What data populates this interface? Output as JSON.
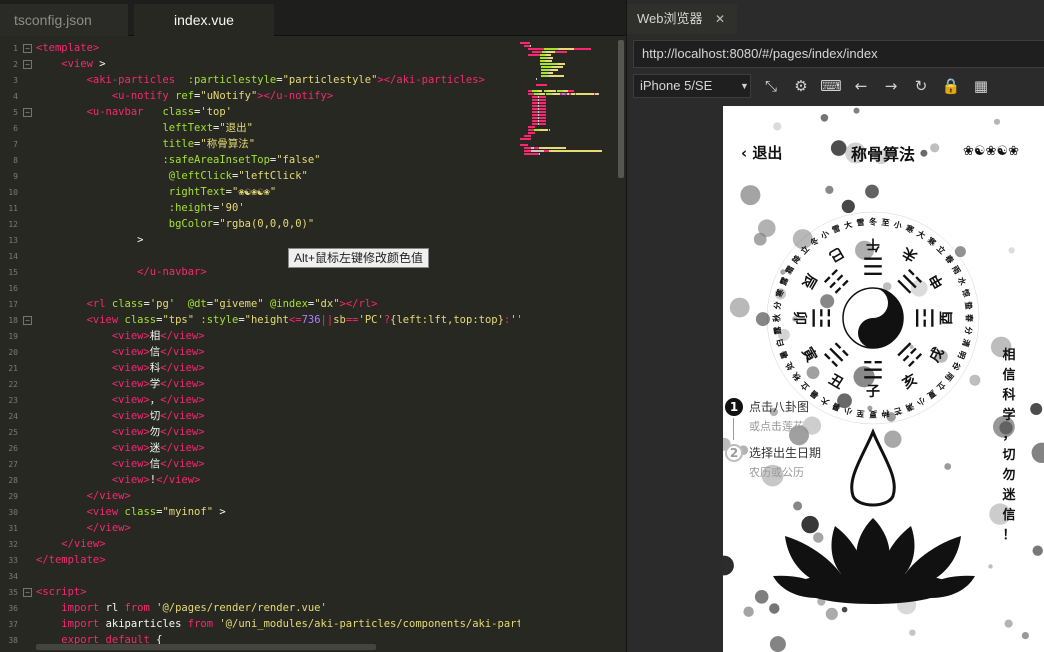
{
  "editor": {
    "tabs": [
      {
        "label": "tsconfig.json",
        "active": false
      },
      {
        "label": "index.vue",
        "active": true
      }
    ],
    "line_numbers": [
      "1",
      "2",
      "3",
      "4",
      "5",
      "6",
      "7",
      "8",
      "9",
      "10",
      "11",
      "12",
      "13",
      "14",
      "15",
      "16",
      "17",
      "18",
      "19",
      "20",
      "21",
      "22",
      "23",
      "24",
      "25",
      "26",
      "27",
      "28",
      "29",
      "30",
      "31",
      "32",
      "33",
      "34",
      "35",
      "36",
      "37",
      "38"
    ],
    "fold_lines": [
      1,
      2,
      5,
      18,
      35
    ],
    "lines": [
      [
        [
          "t",
          "<template>"
        ]
      ],
      [
        [
          "w",
          "    "
        ],
        [
          "t",
          "<view "
        ],
        [
          "p",
          ">"
        ]
      ],
      [
        [
          "w",
          "        "
        ],
        [
          "t",
          "<aki-particles  "
        ],
        [
          "a",
          ":particlestyle"
        ],
        [
          "p",
          "="
        ],
        [
          "s",
          "\"particlestyle\""
        ],
        [
          "t",
          "></aki-particles>"
        ]
      ],
      [
        [
          "w",
          "            "
        ],
        [
          "t",
          "<u-notify "
        ],
        [
          "a",
          "ref"
        ],
        [
          "p",
          "="
        ],
        [
          "s",
          "\"uNotify\""
        ],
        [
          "t",
          "></u-notify>"
        ]
      ],
      [
        [
          "w",
          "        "
        ],
        [
          "t",
          "<u-navbar   "
        ],
        [
          "a",
          "class"
        ],
        [
          "p",
          "="
        ],
        [
          "s",
          "'top'"
        ]
      ],
      [
        [
          "w",
          "                    "
        ],
        [
          "a",
          "leftText"
        ],
        [
          "p",
          "="
        ],
        [
          "s",
          "\"退出\""
        ]
      ],
      [
        [
          "w",
          "                    "
        ],
        [
          "a",
          "title"
        ],
        [
          "p",
          "="
        ],
        [
          "s",
          "\"称骨算法\""
        ]
      ],
      [
        [
          "w",
          "                    "
        ],
        [
          "a",
          ":safeAreaInsetTop"
        ],
        [
          "p",
          "="
        ],
        [
          "s",
          "\"false\""
        ]
      ],
      [
        [
          "w",
          "                     "
        ],
        [
          "a",
          "@leftClick"
        ],
        [
          "p",
          "="
        ],
        [
          "s",
          "\"leftClick\""
        ]
      ],
      [
        [
          "w",
          "                     "
        ],
        [
          "a",
          "rightText"
        ],
        [
          "p",
          "="
        ],
        [
          "s",
          "\"❀☯❀☯❀\""
        ]
      ],
      [
        [
          "w",
          "                     "
        ],
        [
          "a",
          ":height"
        ],
        [
          "p",
          "="
        ],
        [
          "s",
          "'90'"
        ]
      ],
      [
        [
          "w",
          "                     "
        ],
        [
          "a",
          "bgColor"
        ],
        [
          "p",
          "="
        ],
        [
          "s",
          "\"rgba(0,0,0,0)\""
        ]
      ],
      [
        [
          "w",
          "                "
        ],
        [
          "p",
          ">"
        ]
      ],
      [
        [
          "w",
          ""
        ]
      ],
      [
        [
          "w",
          "                "
        ],
        [
          "t",
          "</u-navbar>"
        ]
      ],
      [
        [
          "w",
          ""
        ]
      ],
      [
        [
          "w",
          "        "
        ],
        [
          "t",
          "<rl "
        ],
        [
          "a",
          "class"
        ],
        [
          "p",
          "="
        ],
        [
          "s",
          "'pg'"
        ],
        [
          "w",
          "  "
        ],
        [
          "a",
          "@dt"
        ],
        [
          "p",
          "="
        ],
        [
          "s",
          "\"giveme\""
        ],
        [
          "w",
          " "
        ],
        [
          "a",
          "@index"
        ],
        [
          "p",
          "="
        ],
        [
          "s",
          "\"dx\""
        ],
        [
          "t",
          "></rl>"
        ]
      ],
      [
        [
          "w",
          "        "
        ],
        [
          "t",
          "<view "
        ],
        [
          "a",
          "class"
        ],
        [
          "p",
          "="
        ],
        [
          "s",
          "\"tps\""
        ],
        [
          "w",
          " "
        ],
        [
          "a",
          ":style"
        ],
        [
          "p",
          "="
        ],
        [
          "s",
          "\"height"
        ],
        [
          "k",
          "<="
        ],
        [
          "n",
          "736"
        ],
        [
          "k",
          "||"
        ],
        [
          "s",
          "sb"
        ],
        [
          "k",
          "=="
        ],
        [
          "s",
          "'PC'"
        ],
        [
          "k",
          "?"
        ],
        [
          "s",
          "{left:lft,top:top}"
        ],
        [
          "k",
          ":"
        ],
        [
          "s",
          "''\""
        ],
        [
          "p",
          ">"
        ]
      ],
      [
        [
          "w",
          "            "
        ],
        [
          "t",
          "<view>"
        ],
        [
          "p",
          "相"
        ],
        [
          "t",
          "</view>"
        ]
      ],
      [
        [
          "w",
          "            "
        ],
        [
          "t",
          "<view>"
        ],
        [
          "p",
          "信"
        ],
        [
          "t",
          "</view>"
        ]
      ],
      [
        [
          "w",
          "            "
        ],
        [
          "t",
          "<view>"
        ],
        [
          "p",
          "科"
        ],
        [
          "t",
          "</view>"
        ]
      ],
      [
        [
          "w",
          "            "
        ],
        [
          "t",
          "<view>"
        ],
        [
          "p",
          "学"
        ],
        [
          "t",
          "</view>"
        ]
      ],
      [
        [
          "w",
          "            "
        ],
        [
          "t",
          "<view>"
        ],
        [
          "p",
          "，"
        ],
        [
          "t",
          "</view>"
        ]
      ],
      [
        [
          "w",
          "            "
        ],
        [
          "t",
          "<view>"
        ],
        [
          "p",
          "切"
        ],
        [
          "t",
          "</view>"
        ]
      ],
      [
        [
          "w",
          "            "
        ],
        [
          "t",
          "<view>"
        ],
        [
          "p",
          "勿"
        ],
        [
          "t",
          "</view>"
        ]
      ],
      [
        [
          "w",
          "            "
        ],
        [
          "t",
          "<view>"
        ],
        [
          "p",
          "迷"
        ],
        [
          "t",
          "</view>"
        ]
      ],
      [
        [
          "w",
          "            "
        ],
        [
          "t",
          "<view>"
        ],
        [
          "p",
          "信"
        ],
        [
          "t",
          "</view>"
        ]
      ],
      [
        [
          "w",
          "            "
        ],
        [
          "t",
          "<view>"
        ],
        [
          "p",
          "!"
        ],
        [
          "t",
          "</view>"
        ]
      ],
      [
        [
          "w",
          "        "
        ],
        [
          "t",
          "</view>"
        ]
      ],
      [
        [
          "w",
          "        "
        ],
        [
          "t",
          "<view "
        ],
        [
          "a",
          "class"
        ],
        [
          "p",
          "="
        ],
        [
          "s",
          "\"myinof\""
        ],
        [
          "w",
          " "
        ],
        [
          "p",
          ">"
        ]
      ],
      [
        [
          "w",
          "        "
        ],
        [
          "t",
          "</view>"
        ]
      ],
      [
        [
          "w",
          "    "
        ],
        [
          "t",
          "</view>"
        ]
      ],
      [
        [
          "t",
          "</template>"
        ]
      ],
      [
        [
          "w",
          ""
        ]
      ],
      [
        [
          "t",
          "<script>"
        ]
      ],
      [
        [
          "w",
          "    "
        ],
        [
          "k",
          "import "
        ],
        [
          "p",
          "rl "
        ],
        [
          "k",
          "from "
        ],
        [
          "s",
          "'@/pages/render/render.vue'"
        ]
      ],
      [
        [
          "w",
          "    "
        ],
        [
          "k",
          "import "
        ],
        [
          "p",
          "akiparticles "
        ],
        [
          "k",
          "from "
        ],
        [
          "s",
          "'@/uni_modules/aki-particles/components/aki-particles"
        ]
      ],
      [
        [
          "w",
          "    "
        ],
        [
          "k",
          "export default "
        ],
        [
          "p",
          "{"
        ]
      ]
    ],
    "tooltip": "Alt+鼠标左键修改颜色值",
    "colors": {
      "background": "#272822",
      "tag": "#f92672",
      "attribute": "#a6e22e",
      "string": "#e6db74",
      "number": "#ae81ff"
    }
  },
  "browser": {
    "tab_label": "Web浏览器",
    "tab_close": "✕",
    "url": "http://localhost:8080/#/pages/index/index",
    "device": "iPhone 5/SE",
    "device_caret": "▼",
    "toolbar_icons": [
      "screenshot-icon",
      "settings-icon",
      "console-icon",
      "back-arrow-icon",
      "forward-arrow-icon",
      "refresh-icon",
      "lock-icon",
      "qrcode-icon"
    ],
    "toolbar_glyphs": [
      "⤡",
      "⚙",
      "⌨",
      "←",
      "→",
      "↻",
      "🔒",
      "▦"
    ]
  },
  "app": {
    "navbar": {
      "left_text": "退出",
      "left_arrow": "‹",
      "title": "称骨算法",
      "right_text": "❀☯❀☯❀"
    },
    "bagua": {
      "earthly_branches": [
        "子",
        "丑",
        "寅",
        "卯",
        "辰",
        "巳",
        "午",
        "未",
        "申",
        "酉",
        "戌",
        "亥"
      ],
      "solar_terms": "冬至 小寒 大寒 立春 雨水 惊蛰 春分 清明 谷雨 立夏 小满 芒种 夏至 小暑 大暑 立秋 处暑 白露 秋分 寒露 霜降 立冬 小雪 大雪",
      "trigrams": [
        "☰",
        "☱",
        "☲",
        "☳",
        "☴",
        "☵",
        "☶",
        "☷"
      ]
    },
    "motto": [
      "相",
      "信",
      "科",
      "学",
      "，",
      "切",
      "勿",
      "迷",
      "信",
      "！"
    ],
    "steps": [
      {
        "num": "1",
        "title": "点击八卦图",
        "sub": "或点击莲花"
      },
      {
        "num": "2",
        "title": "选择出生日期",
        "sub": "农历或公历"
      }
    ]
  }
}
